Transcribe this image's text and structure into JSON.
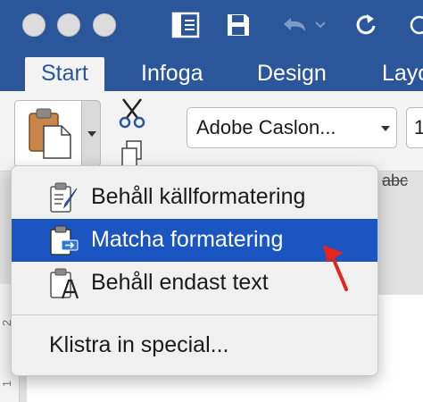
{
  "window": {
    "controls": [
      "close",
      "minimize",
      "zoom"
    ],
    "quick_access_icons": [
      "document-view-icon",
      "save-icon",
      "undo-icon",
      "redo-icon",
      "customize-icon"
    ]
  },
  "tabs": [
    {
      "label": "Start",
      "active": true
    },
    {
      "label": "Infoga",
      "active": false
    },
    {
      "label": "Design",
      "active": false
    },
    {
      "label": "Layo",
      "active": false
    }
  ],
  "ribbon": {
    "font_name": "Adobe Caslon...",
    "font_size": "1",
    "strike_sample": "abc"
  },
  "paste_menu": {
    "items": [
      {
        "label": "Behåll källformatering",
        "icon": "paste-keep-source-icon",
        "highlighted": false
      },
      {
        "label": "Matcha formatering",
        "icon": "paste-match-formatting-icon",
        "highlighted": true
      },
      {
        "label": "Behåll endast text",
        "icon": "paste-text-only-icon",
        "highlighted": false
      }
    ],
    "special_label": "Klistra in special..."
  },
  "ruler": {
    "marks": [
      "2",
      "1"
    ]
  },
  "colors": {
    "brand": "#2b579a",
    "highlight": "#1a55c2",
    "annotation_arrow": "#e8231c"
  }
}
